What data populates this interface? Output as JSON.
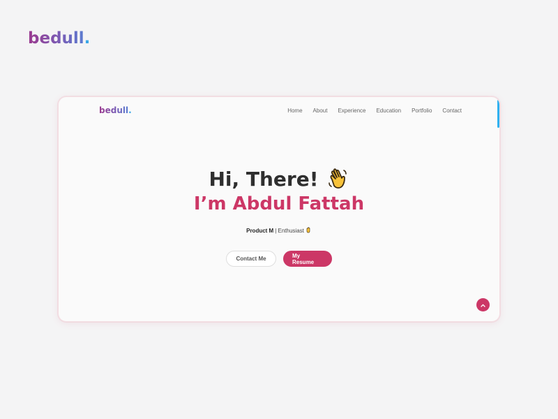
{
  "page": {
    "logo_text": "bedull",
    "logo_dot": "."
  },
  "site": {
    "logo_text": "bedull",
    "logo_dot": ".",
    "nav": [
      "Home",
      "About",
      "Experience",
      "Education",
      "Portfolio",
      "Contact"
    ]
  },
  "hero": {
    "greeting": "Hi, There!",
    "name": "I’m Abdul Fattah",
    "tagline_bold": "Product M",
    "tagline_rest": "| Enthusiast",
    "greeting_icon": "waving-hand-icon",
    "tagline_icon": "raised-hand-icon"
  },
  "buttons": {
    "contact": "Contact Me",
    "resume": "My Resume"
  },
  "back_to_top_icon": "chevron-up-icon",
  "colors": {
    "accent": "#cc3766",
    "scroll_indicator": "#2fb1f0",
    "logo_gradient_start": "#9b3a8f",
    "logo_gradient_end": "#5a7cd1",
    "logo_dot": "#3aa7e6"
  }
}
